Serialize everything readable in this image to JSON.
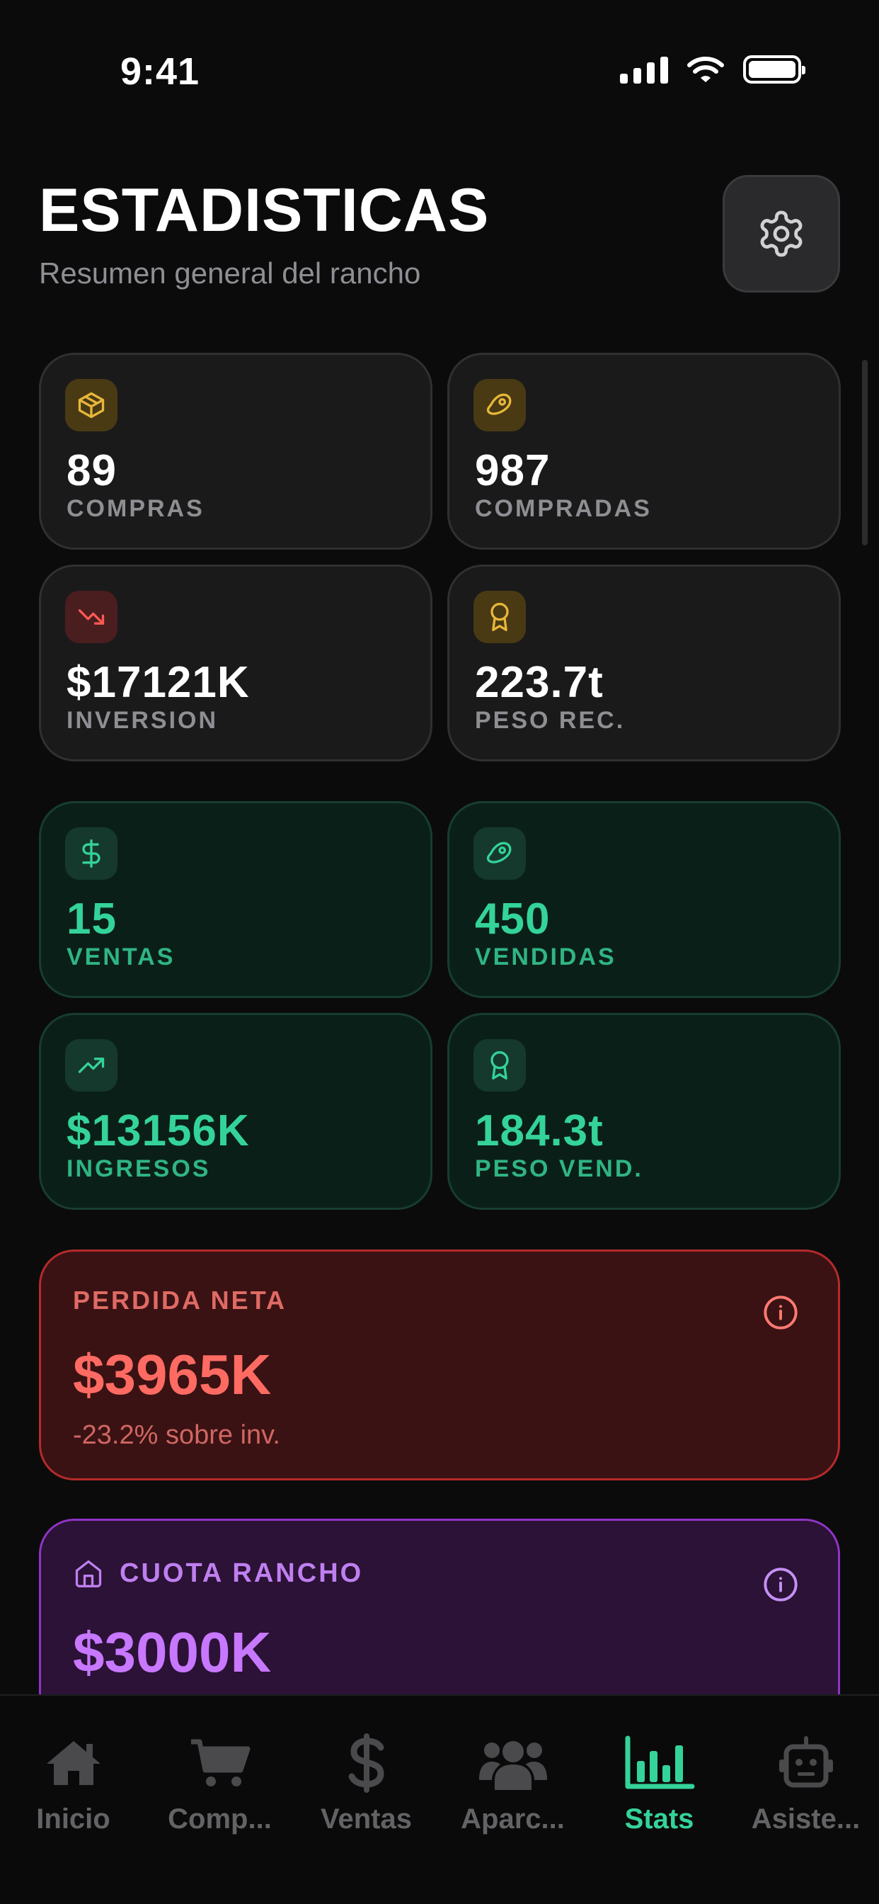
{
  "status_bar": {
    "time": "9:41"
  },
  "header": {
    "title": "ESTADISTICAS",
    "subtitle": "Resumen general del rancho"
  },
  "purchases": [
    {
      "icon": "box-icon",
      "value": "89",
      "label": "COMPRAS"
    },
    {
      "icon": "meat-icon",
      "value": "987",
      "label": "COMPRADAS"
    },
    {
      "icon": "trending-down-icon",
      "value": "$17121K",
      "label": "INVERSION"
    },
    {
      "icon": "award-icon",
      "value": "223.7t",
      "label": "PESO REC."
    }
  ],
  "sales": [
    {
      "icon": "dollar-icon",
      "value": "15",
      "label": "VENTAS"
    },
    {
      "icon": "meat-icon",
      "value": "450",
      "label": "VENDIDAS"
    },
    {
      "icon": "trending-up-icon",
      "value": "$13156K",
      "label": "INGRESOS"
    },
    {
      "icon": "award-icon",
      "value": "184.3t",
      "label": "PESO VEND."
    }
  ],
  "net_loss": {
    "label": "PERDIDA NETA",
    "value": "$3965K",
    "subtext": "-23.2% sobre inv."
  },
  "ranch_fee": {
    "label": "CUOTA RANCHO",
    "value": "$3000K"
  },
  "tabs": [
    {
      "label": "Inicio",
      "icon": "home-icon",
      "active": false
    },
    {
      "label": "Comp...",
      "icon": "cart-icon",
      "active": false
    },
    {
      "label": "Ventas",
      "icon": "dollar-icon",
      "active": false
    },
    {
      "label": "Aparc...",
      "icon": "users-icon",
      "active": false
    },
    {
      "label": "Stats",
      "icon": "bar-chart-icon",
      "active": true
    },
    {
      "label": "Asiste...",
      "icon": "robot-icon",
      "active": false
    }
  ],
  "colors": {
    "accent_green": "#34d399",
    "loss_red": "#ff6b63",
    "fee_purple": "#c778ff",
    "icon_yellow": "#e8b73a"
  }
}
